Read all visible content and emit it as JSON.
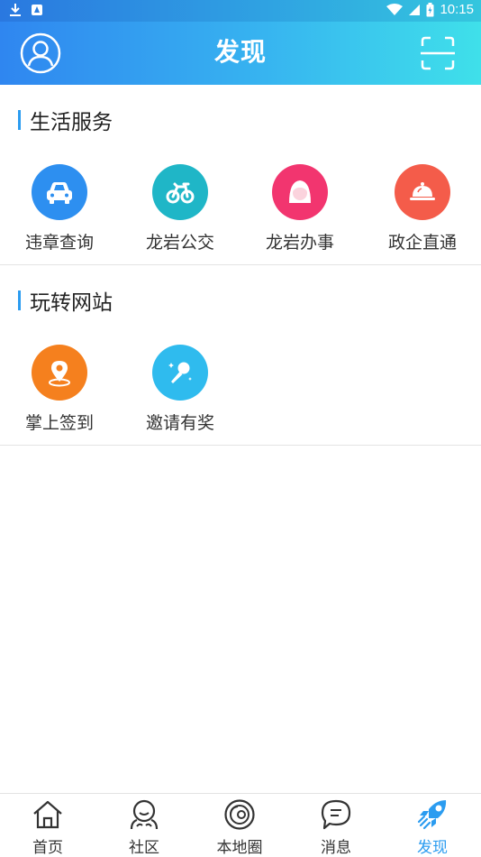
{
  "status_bar": {
    "time": "10:15",
    "left_icons": [
      "download-icon",
      "notification-icon"
    ],
    "right_icons": [
      "wifi-icon",
      "signal-icon",
      "battery-icon"
    ]
  },
  "header": {
    "title": "发现",
    "left_icon": "user-avatar-icon",
    "right_icon": "scan-icon"
  },
  "sections": [
    {
      "title": "生活服务",
      "items": [
        {
          "label": "违章查询",
          "icon": "car-icon",
          "color": "#2d8ff0"
        },
        {
          "label": "龙岩公交",
          "icon": "bus-icon",
          "color": "#1fb6c7"
        },
        {
          "label": "龙岩办事",
          "icon": "service-icon",
          "color": "#f2356f"
        },
        {
          "label": "政企直通",
          "icon": "service-bell-icon",
          "color": "#f45c4a"
        }
      ]
    },
    {
      "title": "玩转网站",
      "items": [
        {
          "label": "掌上签到",
          "icon": "location-pin-icon",
          "color": "#f5801e"
        },
        {
          "label": "邀请有奖",
          "icon": "microphone-icon",
          "color": "#2fbbee"
        }
      ]
    }
  ],
  "tabbar": {
    "tabs": [
      {
        "label": "首页",
        "icon": "home-icon"
      },
      {
        "label": "社区",
        "icon": "community-icon"
      },
      {
        "label": "本地圈",
        "icon": "local-circle-icon"
      },
      {
        "label": "消息",
        "icon": "message-icon"
      },
      {
        "label": "发现",
        "icon": "discover-rocket-icon",
        "active": true
      }
    ],
    "active_color": "#2b9cf0"
  },
  "colors": {
    "header_gradient_start": "#2f86f0",
    "header_gradient_end": "#3fe0ea",
    "section_accent": "#2b9cf0"
  }
}
